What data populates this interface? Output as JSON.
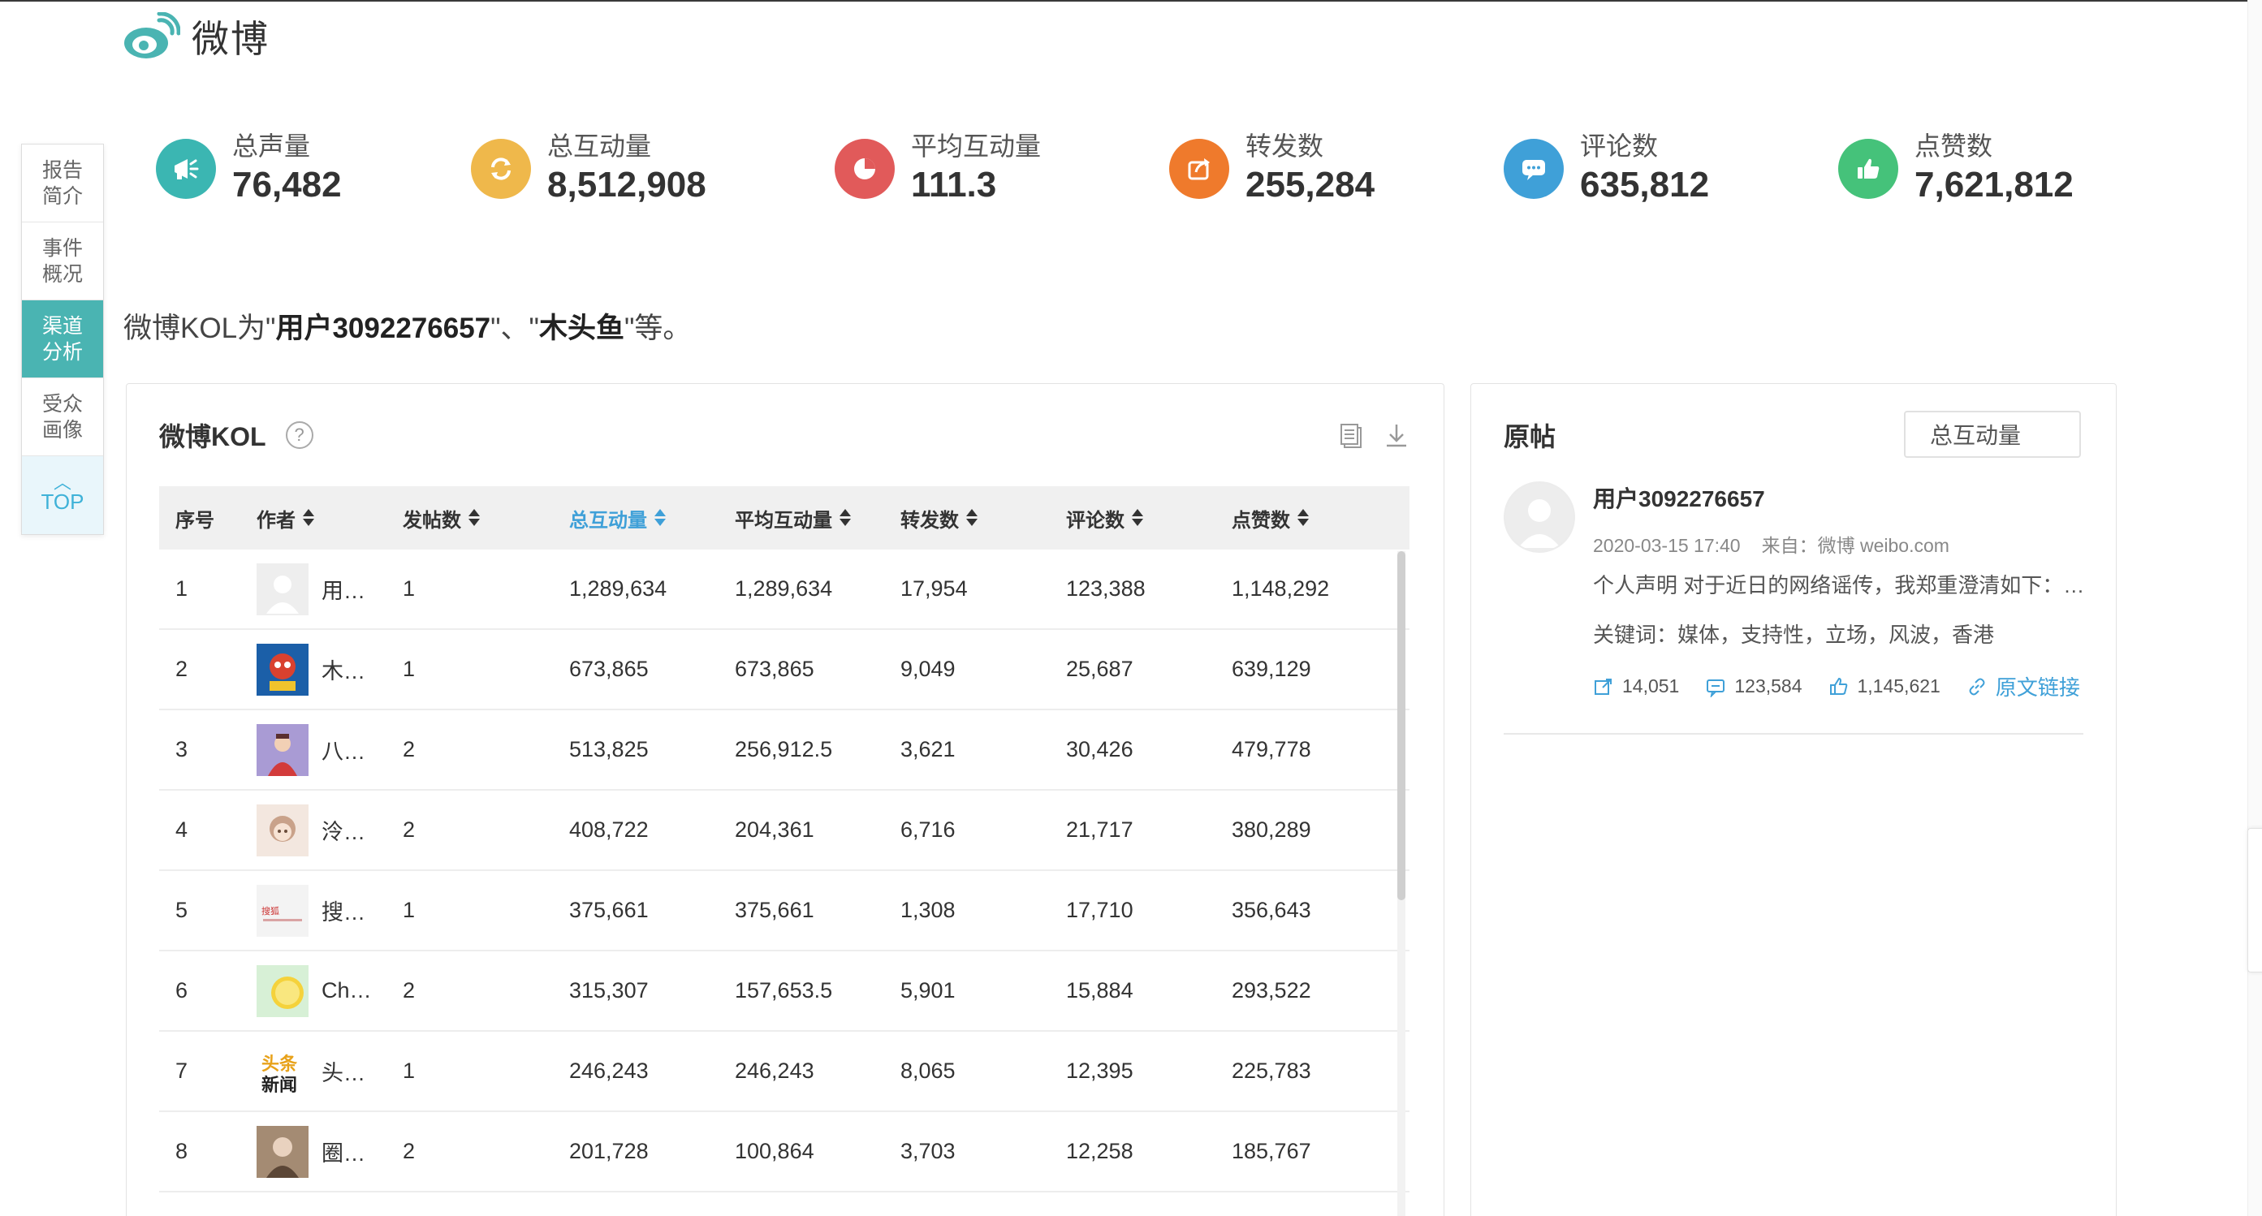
{
  "brand": {
    "name": "微博"
  },
  "sidenav": {
    "items": [
      {
        "label": "报告简介"
      },
      {
        "label": "事件概况"
      },
      {
        "label": "渠道分析",
        "active": true
      },
      {
        "label": "受众画像"
      }
    ],
    "top_label": "TOP"
  },
  "stats": [
    {
      "label": "总声量",
      "value": "76,482",
      "icon": "megaphone-icon",
      "color": "#3bb6b2"
    },
    {
      "label": "总互动量",
      "value": "8,512,908",
      "icon": "refresh-icon",
      "color": "#efb84b"
    },
    {
      "label": "平均互动量",
      "value": "111.3",
      "icon": "pie-icon",
      "color": "#e15a5a"
    },
    {
      "label": "转发数",
      "value": "255,284",
      "icon": "share-icon",
      "color": "#ef7a2c"
    },
    {
      "label": "评论数",
      "value": "635,812",
      "icon": "comment-icon",
      "color": "#3fa0d8"
    },
    {
      "label": "点赞数",
      "value": "7,621,812",
      "icon": "thumbs-up-icon",
      "color": "#45c27a"
    }
  ],
  "summary": {
    "prefix": "微博KOL为\"",
    "name1": "用户3092276657",
    "sep": "\"、\"",
    "name2": "木头鱼",
    "suffix": "\"等。"
  },
  "kol": {
    "title": "微博KOL",
    "columns": [
      "序号",
      "作者",
      "发帖数",
      "总互动量",
      "平均互动量",
      "转发数",
      "评论数",
      "点赞数"
    ],
    "rows": [
      {
        "rank": "1",
        "author": "用…",
        "posts": "1",
        "total": "1,289,634",
        "avg": "1,289,634",
        "reposts": "17,954",
        "comments": "123,388",
        "likes": "1,148,292",
        "avatar": "default"
      },
      {
        "rank": "2",
        "author": "木…",
        "posts": "1",
        "total": "673,865",
        "avg": "673,865",
        "reposts": "9,049",
        "comments": "25,687",
        "likes": "639,129",
        "avatar": "blue"
      },
      {
        "rank": "3",
        "author": "八…",
        "posts": "2",
        "total": "513,825",
        "avg": "256,912.5",
        "reposts": "3,621",
        "comments": "30,426",
        "likes": "479,778",
        "avatar": "purple"
      },
      {
        "rank": "4",
        "author": "泠…",
        "posts": "2",
        "total": "408,722",
        "avg": "204,361",
        "reposts": "6,716",
        "comments": "21,717",
        "likes": "380,289",
        "avatar": "girl"
      },
      {
        "rank": "5",
        "author": "搜…",
        "posts": "1",
        "total": "375,661",
        "avg": "375,661",
        "reposts": "1,308",
        "comments": "17,710",
        "likes": "356,643",
        "avatar": "sohu"
      },
      {
        "rank": "6",
        "author": "Ch…",
        "posts": "2",
        "total": "315,307",
        "avg": "157,653.5",
        "reposts": "5,901",
        "comments": "15,884",
        "likes": "293,522",
        "avatar": "lemon"
      },
      {
        "rank": "7",
        "author": "头…",
        "posts": "1",
        "total": "246,243",
        "avg": "246,243",
        "reposts": "8,065",
        "comments": "12,395",
        "likes": "225,783",
        "avatar": "toutiao"
      },
      {
        "rank": "8",
        "author": "圈…",
        "posts": "2",
        "total": "201,728",
        "avg": "100,864",
        "reposts": "3,703",
        "comments": "12,258",
        "likes": "185,767",
        "avatar": "brown"
      }
    ]
  },
  "post_panel": {
    "title": "原帖",
    "metric_select": "总互动量",
    "post": {
      "user": "用户3092276657",
      "time": "2020-03-15 17:40",
      "source": "来自：微博 weibo.com",
      "text": "个人声明 对于近日的网络谣传，我郑重澄清如下：…",
      "keywords": "关键词：媒体，支持性，立场，风波，香港",
      "reposts": "14,051",
      "comments": "123,584",
      "likes": "1,145,621",
      "link_label": "原文链接"
    }
  }
}
